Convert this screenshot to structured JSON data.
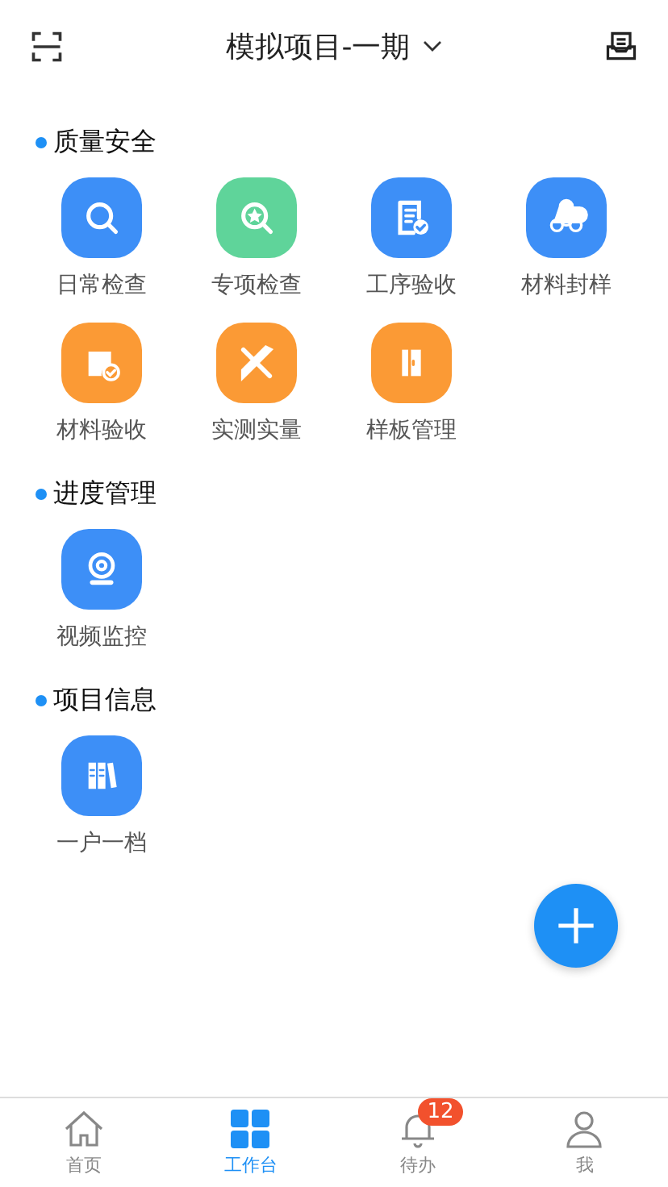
{
  "header": {
    "title": "模拟项目-一期"
  },
  "sections": [
    {
      "title": "质量安全",
      "apps": [
        {
          "label": "日常检查",
          "kind": "search",
          "color": "#3d8ff7"
        },
        {
          "label": "专项检查",
          "kind": "star-search",
          "color": "#5fd49a"
        },
        {
          "label": "工序验收",
          "kind": "clipboard",
          "color": "#3d8ff7"
        },
        {
          "label": "材料封样",
          "kind": "rolls",
          "color": "#3d8ff7"
        },
        {
          "label": "材料验收",
          "kind": "box",
          "color": "#fb9a35"
        },
        {
          "label": "实测实量",
          "kind": "ruler",
          "color": "#fb9a35"
        },
        {
          "label": "样板管理",
          "kind": "door",
          "color": "#fb9a35"
        }
      ]
    },
    {
      "title": "进度管理",
      "apps": [
        {
          "label": "视频监控",
          "kind": "camera",
          "color": "#3d8ff7"
        }
      ]
    },
    {
      "title": "项目信息",
      "apps": [
        {
          "label": "一户一档",
          "kind": "books",
          "color": "#3d8ff7"
        }
      ]
    }
  ],
  "tabs": [
    {
      "label": "首页",
      "kind": "home",
      "selected": false
    },
    {
      "label": "工作台",
      "kind": "grid",
      "selected": true
    },
    {
      "label": "待办",
      "kind": "bell",
      "selected": false,
      "badge": "12"
    },
    {
      "label": "我",
      "kind": "person",
      "selected": false
    }
  ]
}
